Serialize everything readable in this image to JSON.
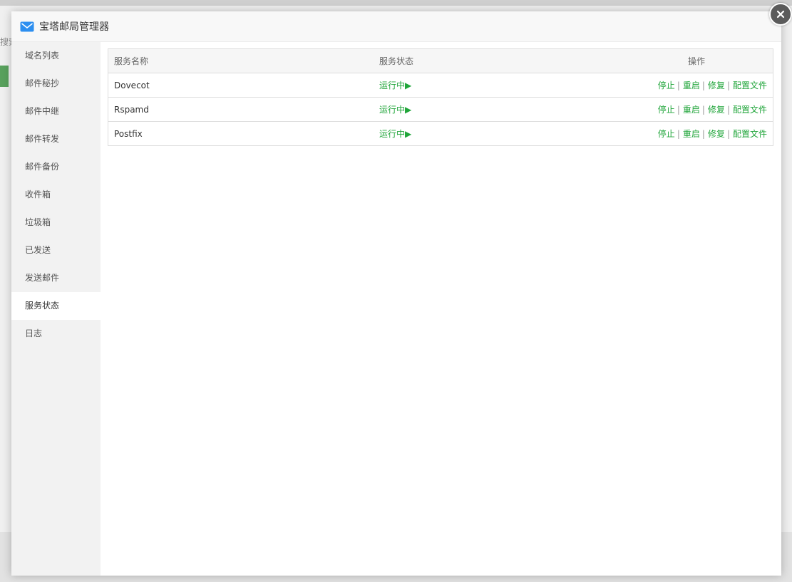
{
  "modal": {
    "title": "宝塔邮局管理器",
    "icon": "mail-icon",
    "close_icon": "close-icon"
  },
  "sidebar": {
    "items": [
      {
        "label": "域名列表"
      },
      {
        "label": "邮件秘抄"
      },
      {
        "label": "邮件中继"
      },
      {
        "label": "邮件转发"
      },
      {
        "label": "邮件备份"
      },
      {
        "label": "收件箱"
      },
      {
        "label": "垃圾箱"
      },
      {
        "label": "已发送"
      },
      {
        "label": "发送邮件"
      },
      {
        "label": "服务状态",
        "active": true
      },
      {
        "label": "日志"
      }
    ]
  },
  "services": {
    "headers": {
      "name": "服务名称",
      "status": "服务状态",
      "ops": "操作"
    },
    "op_labels": {
      "stop": "停止",
      "restart": "重启",
      "repair": "修复",
      "config": "配置文件"
    },
    "separator": "|",
    "rows": [
      {
        "name": "Dovecot",
        "status": "运行中▶"
      },
      {
        "name": "Rspamd",
        "status": "运行中▶"
      },
      {
        "name": "Postfix",
        "status": "运行中▶"
      }
    ]
  },
  "background": {
    "search_label": "搜索"
  },
  "colors": {
    "accent": "#20a53a",
    "sidebar_bg": "#f2f2f2",
    "close_bg": "#5b5b5b"
  }
}
